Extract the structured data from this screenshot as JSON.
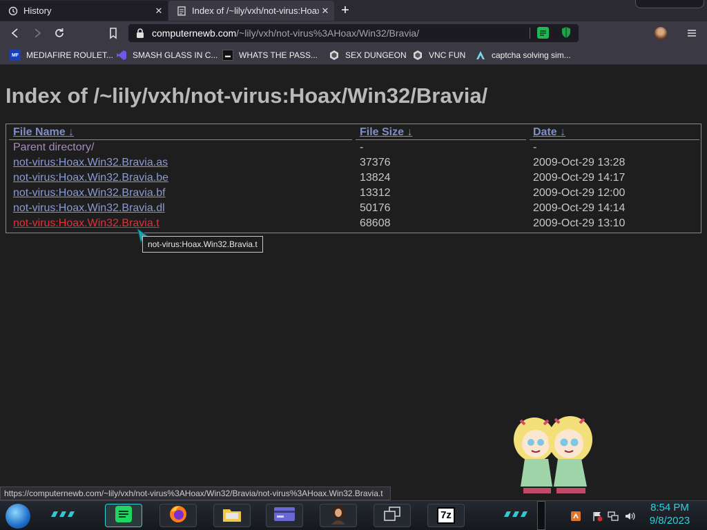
{
  "tabs": [
    {
      "title": "History",
      "icon": "history-icon",
      "active": false
    },
    {
      "title": "Index of /~lily/vxh/not-virus:Hoax/",
      "icon": "page-icon",
      "active": true
    }
  ],
  "address": {
    "host": "computernewb.com",
    "path": "/~lily/vxh/not-virus%3AHoax/Win32/Bravia/"
  },
  "bookmarks": [
    {
      "label": "MEDIAFIRE ROULET...",
      "icon": "mediafire-icon"
    },
    {
      "label": "SMASH GLASS IN C...",
      "icon": "visual-studio-icon"
    },
    {
      "label": "WHATS THE PASS...",
      "icon": "dark-square-icon"
    },
    {
      "label": "SEX DUNGEON",
      "icon": "vnc-icon"
    },
    {
      "label": "VNC FUN",
      "icon": "vnc-icon"
    },
    {
      "label": "captcha solving sim...",
      "icon": "triangle-logo-icon"
    }
  ],
  "page": {
    "heading": "Index of /~lily/vxh/not-virus:Hoax/Win32/Bravia/",
    "columns": {
      "name": "File Name",
      "size": "File Size",
      "date": "Date",
      "sort_arrow": "↓"
    },
    "rows": [
      {
        "name": "Parent directory/",
        "size": "-",
        "date": "-",
        "state": "visited"
      },
      {
        "name": "not-virus:Hoax.Win32.Bravia.as",
        "size": "37376",
        "date": "2009-Oct-29 13:28",
        "state": "link"
      },
      {
        "name": "not-virus:Hoax.Win32.Bravia.be",
        "size": "13824",
        "date": "2009-Oct-29 14:17",
        "state": "link"
      },
      {
        "name": "not-virus:Hoax.Win32.Bravia.bf",
        "size": "13312",
        "date": "2009-Oct-29 12:00",
        "state": "link"
      },
      {
        "name": "not-virus:Hoax.Win32.Bravia.dl",
        "size": "50176",
        "date": "2009-Oct-29 14:14",
        "state": "link"
      },
      {
        "name": "not-virus:Hoax.Win32.Bravia.t",
        "size": "68608",
        "date": "2009-Oct-29 13:10",
        "state": "hover"
      }
    ],
    "tooltip": "not-virus:Hoax.Win32.Bravia.t"
  },
  "status_url": "https://computernewb.com/~lily/vxh/not-virus%3AHoax/Win32/Bravia/not-virus%3AHoax.Win32.Bravia.t",
  "taskbar": {
    "apps": [
      "start-orb-icon",
      "spotify-icon",
      "firefox-icon",
      "file-explorer-icon",
      "card-app-icon",
      "portrait-app-icon",
      "window-switcher-icon",
      "7zip-icon"
    ],
    "sevenzip_label": "7z",
    "time": "8:54 PM",
    "date": "9/8/2023"
  },
  "colors": {
    "link": "#8a9ad4",
    "visited": "#a78ac4",
    "hover": "#e0303a",
    "accent": "#2fd1e0"
  }
}
